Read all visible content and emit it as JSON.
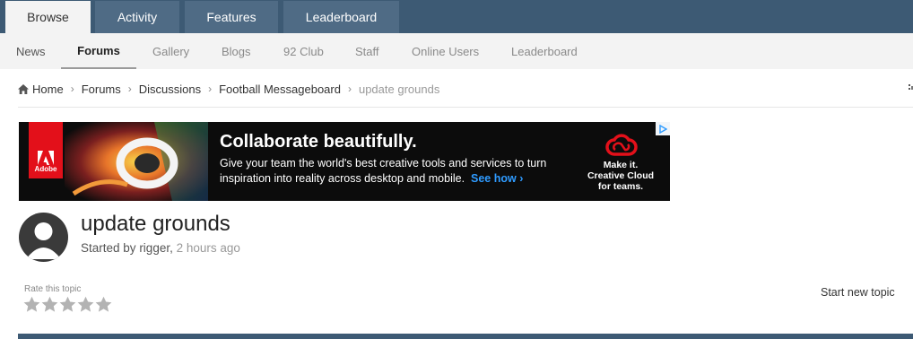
{
  "primary_nav": {
    "tabs": [
      {
        "label": "Browse"
      },
      {
        "label": "Activity"
      },
      {
        "label": "Features"
      },
      {
        "label": "Leaderboard"
      }
    ]
  },
  "secondary_nav": {
    "tabs": [
      {
        "label": "News"
      },
      {
        "label": "Forums"
      },
      {
        "label": "Gallery"
      },
      {
        "label": "Blogs"
      },
      {
        "label": "92 Club"
      },
      {
        "label": "Staff"
      },
      {
        "label": "Online Users"
      },
      {
        "label": "Leaderboard"
      }
    ]
  },
  "breadcrumb": {
    "items": [
      "Home",
      "Forums",
      "Discussions",
      "Football Messageboard"
    ],
    "current": "update grounds"
  },
  "ad": {
    "brand": "Adobe",
    "headline": "Collaborate beautifully.",
    "body_line1": "Give your team the world's best creative tools and services to turn",
    "body_line2": "inspiration into reality across desktop and mobile.",
    "cta": "See how ›",
    "tagline_line1": "Make it.",
    "tagline_line2": "Creative Cloud",
    "tagline_line3": "for teams."
  },
  "topic": {
    "title": "update grounds",
    "started_by_prefix": "Started by",
    "author": "rigger",
    "separator": ",",
    "time_ago": "2 hours ago"
  },
  "rating": {
    "label": "Rate this topic",
    "stars_filled": 0,
    "stars_total": 5
  },
  "actions": {
    "start_new_topic": "Start new topic"
  },
  "colors": {
    "nav_bg": "#3d5a74",
    "nav_tab": "#4f6b85",
    "ad_red": "#e3101a",
    "ad_link": "#2f9bff"
  }
}
